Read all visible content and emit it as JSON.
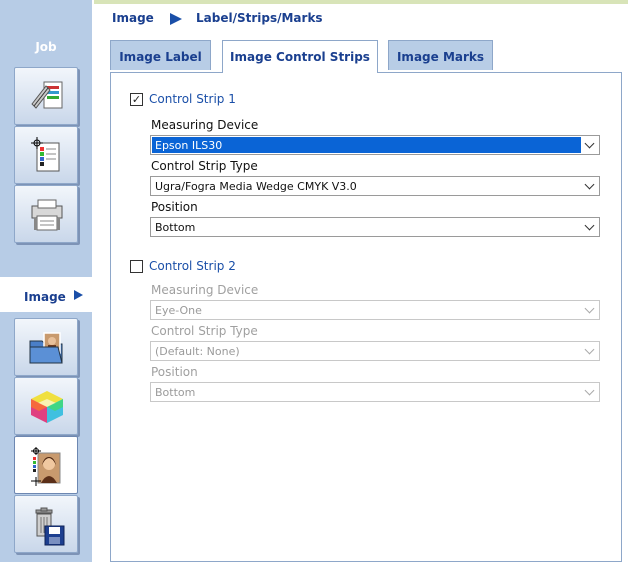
{
  "sidebar": {
    "job_title": "Job",
    "image_title": "Image",
    "job_buttons": [
      {
        "icon": "layout-icon"
      },
      {
        "icon": "page-marks-icon"
      },
      {
        "icon": "printer-icon"
      }
    ],
    "image_buttons": [
      {
        "icon": "image-folder-icon"
      },
      {
        "icon": "color-cube-icon"
      },
      {
        "icon": "image-portrait-marks-icon"
      },
      {
        "icon": "trash-save-icon"
      }
    ]
  },
  "header": {
    "section": "Image",
    "page": "Label/Strips/Marks"
  },
  "tabs": [
    {
      "label": "Image Label",
      "active": false
    },
    {
      "label": "Image Control Strips",
      "active": true
    },
    {
      "label": "Image Marks",
      "active": false
    }
  ],
  "strip1": {
    "checked": true,
    "label": "Control Strip 1",
    "measuring_device_label": "Measuring Device",
    "measuring_device_value": "Epson ILS30",
    "strip_type_label": "Control Strip Type",
    "strip_type_value": "Ugra/Fogra Media Wedge CMYK V3.0",
    "position_label": "Position",
    "position_value": "Bottom"
  },
  "strip2": {
    "checked": false,
    "label": "Control Strip 2",
    "measuring_device_label": "Measuring Device",
    "measuring_device_value": "Eye-One",
    "strip_type_label": "Control Strip Type",
    "strip_type_value": "(Default: None)",
    "position_label": "Position",
    "position_value": "Bottom"
  },
  "colors": {
    "accent": "#1a3f8f",
    "sidebar_bg": "#b7cce6",
    "selection": "#0a64d6"
  }
}
